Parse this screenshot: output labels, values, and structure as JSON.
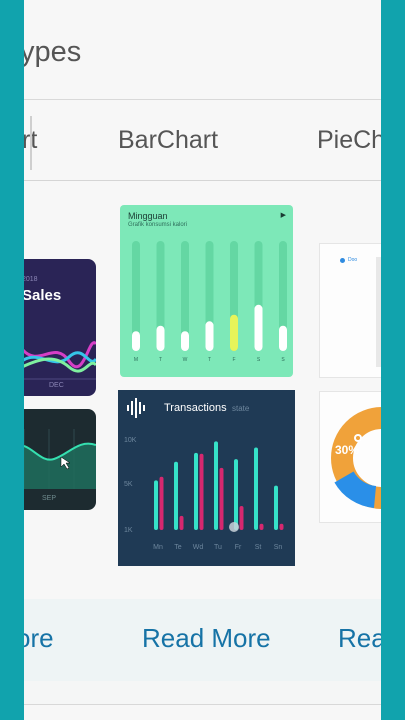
{
  "header": {
    "title": "ypes"
  },
  "tabs": [
    {
      "label": "rt"
    },
    {
      "label": "BarChart"
    },
    {
      "label": "PieCh"
    }
  ],
  "cards": {
    "sales": {
      "year": "2018",
      "title": "Sales",
      "month": "DEC"
    },
    "area": {
      "month": "SEP"
    },
    "weekly": {
      "title": "Mingguan",
      "subtitle": "Grafik konsumsi kalori",
      "days": [
        "M",
        "T",
        "W",
        "T",
        "F",
        "S",
        "S"
      ],
      "values": [
        0.18,
        0.23,
        0.18,
        0.27,
        0.33,
        0.42,
        0.23
      ],
      "highlight_index": 4
    },
    "transactions": {
      "title": "Transactions",
      "subtitle": "state",
      "y_ticks": [
        "10K",
        "5K",
        "1K"
      ],
      "days": [
        "Mn",
        "Te",
        "Wd",
        "Tu",
        "Fr",
        "St",
        "Sn"
      ]
    },
    "pie_legend": {
      "label": "Doo"
    },
    "donut": {
      "label": "30%"
    }
  },
  "chart_data": [
    {
      "type": "bar",
      "title": "Mingguan",
      "subtitle": "Grafik konsumsi kalori",
      "categories": [
        "M",
        "T",
        "W",
        "T",
        "F",
        "S",
        "S"
      ],
      "values": [
        0.18,
        0.23,
        0.18,
        0.27,
        0.33,
        0.42,
        0.23
      ],
      "ylim": [
        0,
        1
      ]
    },
    {
      "type": "bar",
      "title": "Transactions",
      "categories": [
        "Mn",
        "Te",
        "Wd",
        "Tu",
        "Fr",
        "St",
        "Sn"
      ],
      "y_ticks": [
        "1K",
        "5K",
        "10K"
      ],
      "series": [
        {
          "values": [
            5600,
            7700,
            8700,
            10000,
            8000,
            9300,
            5000
          ]
        },
        {
          "values": [
            6000,
            1600,
            8600,
            7000,
            2700,
            700,
            700
          ]
        }
      ],
      "ylim": [
        0,
        12000
      ]
    }
  ],
  "footer": {
    "read_more": [
      "ore",
      "Read More",
      "Rea"
    ]
  },
  "colors": {
    "frame": "#11a3ad",
    "link": "#1673a6",
    "mint": "#7de8b8",
    "navy": "#1f3a55",
    "cyan": "#36e2c9",
    "magenta": "#d6286f"
  }
}
